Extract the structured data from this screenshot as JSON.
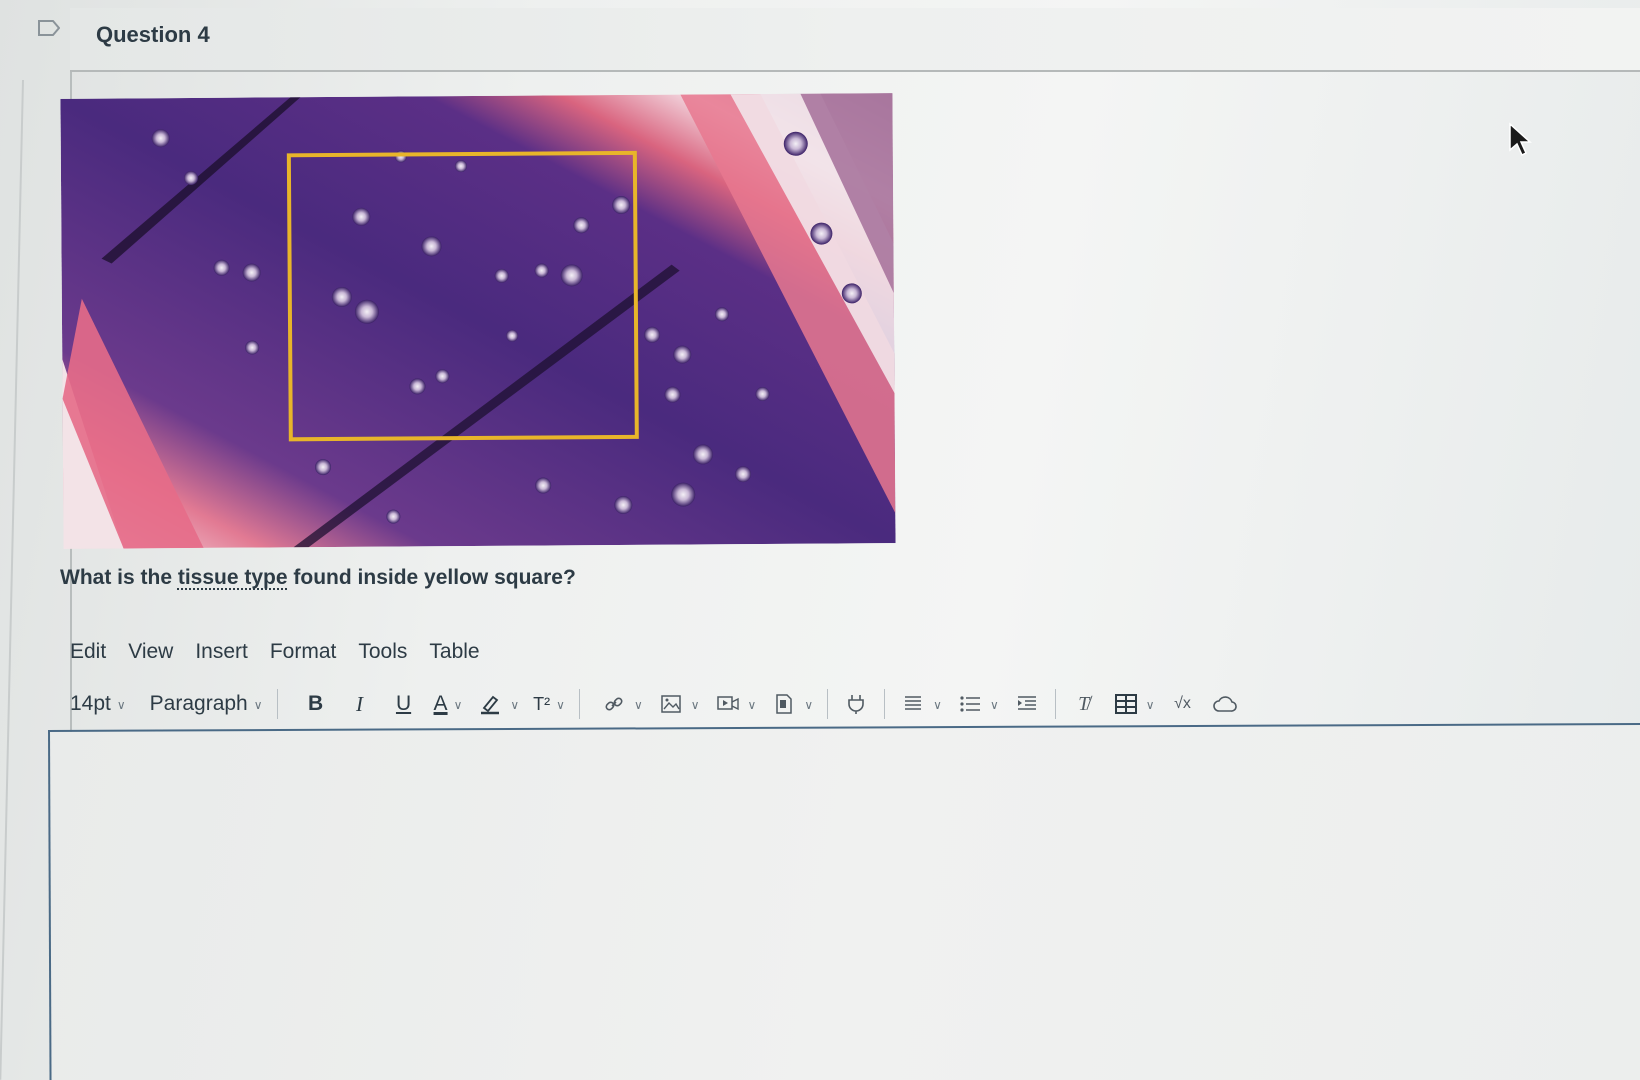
{
  "question": {
    "title": "Question 4",
    "text_before": "What is the ",
    "text_link": "tissue type",
    "text_after": " found inside yellow square?"
  },
  "image": {
    "description_icon": "histology-image",
    "highlight_color": "#e8b52a"
  },
  "editor": {
    "menu": [
      "Edit",
      "View",
      "Insert",
      "Format",
      "Tools",
      "Table"
    ],
    "font_size": "14pt",
    "block_format": "Paragraph",
    "bold_label": "B",
    "italic_label": "I",
    "underline_label": "U",
    "text_color_label": "A",
    "superscript_label": "T²",
    "content": ""
  },
  "colors": {
    "border_accent": "#4a6a86",
    "text": "#2d3b45"
  }
}
